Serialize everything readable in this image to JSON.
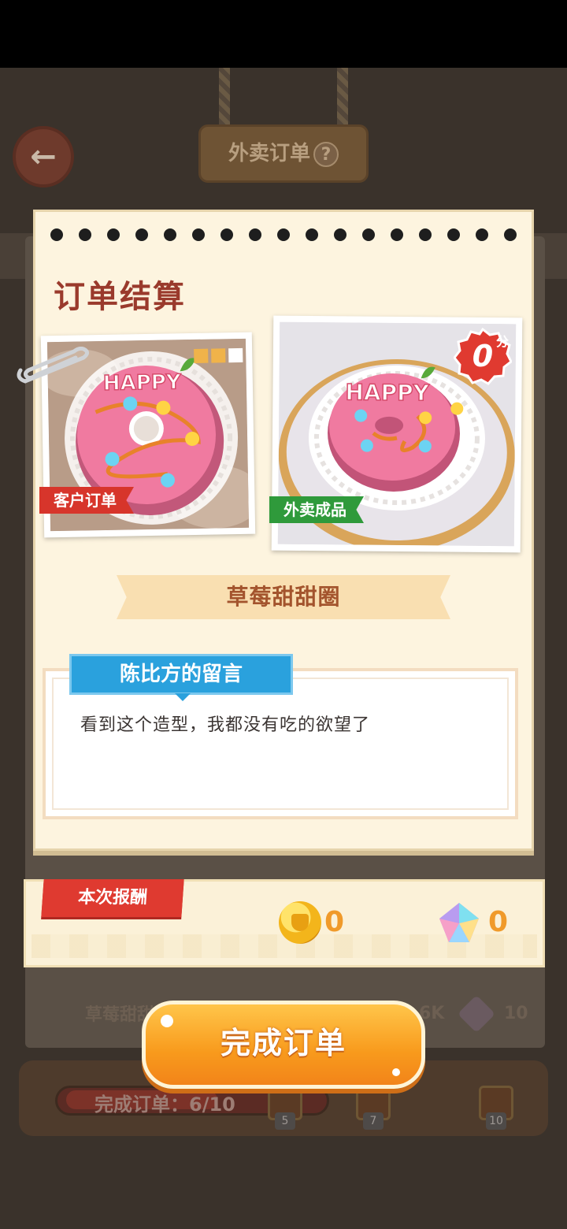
{
  "background": {
    "header_title": "外卖订单",
    "help_label": "?",
    "back_label": "←",
    "bg_order_name": "草莓甜甜",
    "bg_coin_amount": "6K",
    "bg_gem_amount": "10",
    "progress_label": "完成订单：6/10",
    "progress_fraction": 0.6,
    "milestones": [
      "5",
      "7",
      "10"
    ]
  },
  "card": {
    "title": "订单结算",
    "customer_tag": "客户订单",
    "product_tag": "外卖成品",
    "score": "0",
    "score_unit": "分",
    "donut_text": "HAPPY",
    "dish_name": "草莓甜甜圈",
    "message_header": "陈比方的留言",
    "message_text": "看到这个造型，我都没有吃的欲望了"
  },
  "reward": {
    "label": "本次报酬",
    "coins": "0",
    "gems": "0"
  },
  "action": {
    "complete_label": "完成订单"
  },
  "colors": {
    "accent_orange": "#f89a1c",
    "title_red": "#9a3a2c",
    "tag_red": "#d7352b",
    "tag_green": "#2f9a3b",
    "message_blue": "#2aa1dd"
  }
}
